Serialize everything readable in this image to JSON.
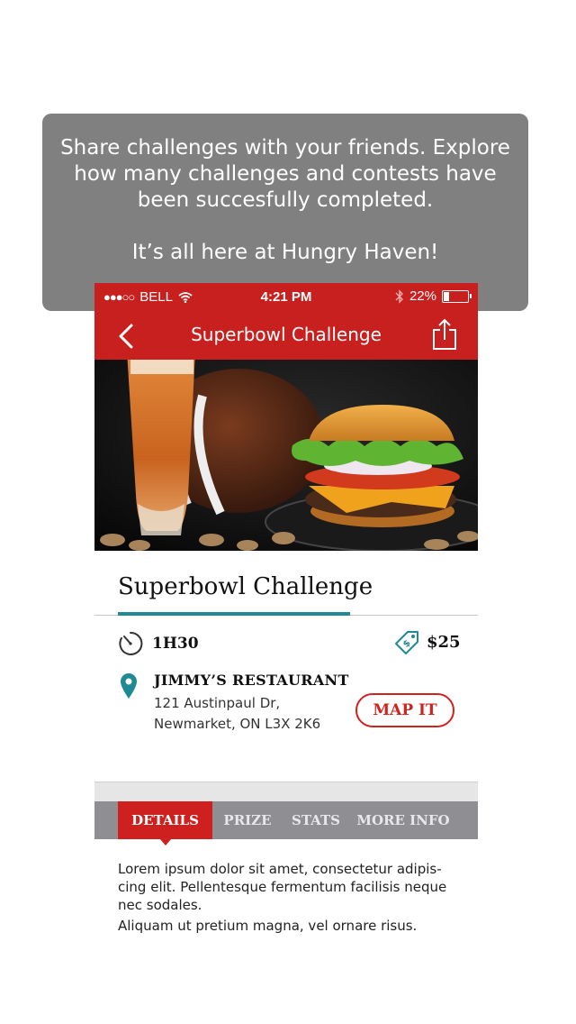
{
  "callout": {
    "lines": [
      "Share challenges with your friends. Explore",
      "how many challenges and contests have",
      "been succesfully completed."
    ],
    "tagline": "It’s all here at Hungry Haven!"
  },
  "status_bar": {
    "signal": "●●●○○",
    "carrier": "BELL",
    "time": "4:21 PM",
    "battery": "22%"
  },
  "nav": {
    "title": "Superbowl Challenge"
  },
  "challenge": {
    "title": "Superbowl Challenge",
    "duration": "1H30",
    "price": "$25",
    "restaurant": "JIMMY’S RESTAURANT",
    "address_line1": "121 Austinpaul Dr,",
    "address_line2": "Newmarket, ON L3X 2K6",
    "map_button": "MAP IT"
  },
  "tabs": [
    {
      "label": "DETAILS",
      "active": true
    },
    {
      "label": "PRIZE",
      "active": false
    },
    {
      "label": "STATS",
      "active": false
    },
    {
      "label": "MORE INFO",
      "active": false
    }
  ],
  "details": {
    "paragraph1": "Lorem ipsum dolor sit amet, consectetur adipis-cing elit. Pellentesque fermentum facilisis neque nec sodales.",
    "paragraph2": "Aliquam ut pretium magna, vel ornare risus."
  },
  "colors": {
    "brand_red": "#c8201f",
    "accent_teal": "#1f8a94",
    "tab_grey": "#8f8f93",
    "callout_grey": "#808080"
  },
  "icons": {
    "back": "chevron-left-icon",
    "share": "share-icon",
    "duration": "timer-icon",
    "price": "price-tag-icon",
    "location": "map-pin-icon",
    "wifi": "wifi-icon",
    "bluetooth": "bluetooth-icon",
    "battery": "battery-icon"
  }
}
